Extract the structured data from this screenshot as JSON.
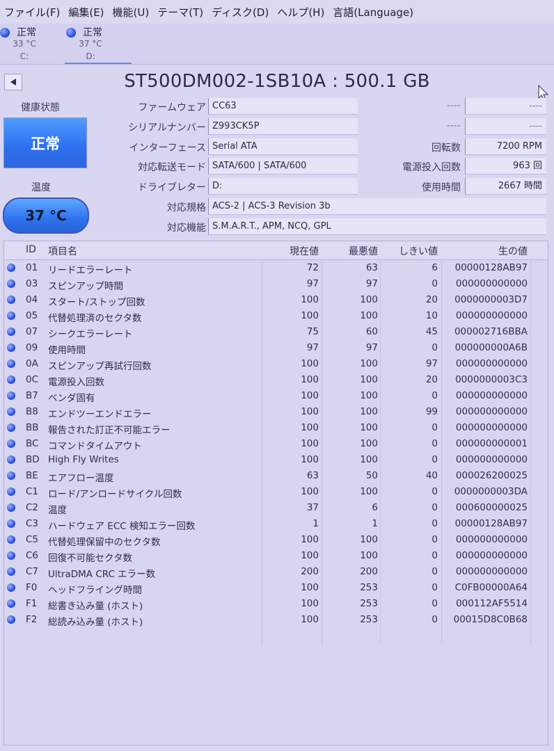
{
  "menu": [
    "ファイル(F)",
    "編集(E)",
    "機能(U)",
    "テーマ(T)",
    "ディスク(D)",
    "ヘルプ(H)",
    "言語(Language)"
  ],
  "drives": [
    {
      "status": "正常",
      "temp": "33 °C",
      "letter": "C:"
    },
    {
      "status": "正常",
      "temp": "37 °C",
      "letter": "D:"
    }
  ],
  "title": "ST500DM002-1SB10A : 500.1 GB",
  "health": {
    "label": "健康状態",
    "value": "正常"
  },
  "temperature": {
    "label": "温度",
    "value": "37 °C"
  },
  "info": {
    "firmware": {
      "label": "ファームウェア",
      "value": "CC63"
    },
    "serial": {
      "label": "シリアルナンバー",
      "value": "Z993CK5P"
    },
    "interface": {
      "label": "インターフェース",
      "value": "Serial ATA"
    },
    "transfer": {
      "label": "対応転送モード",
      "value": "SATA/600 | SATA/600"
    },
    "drive_letter": {
      "label": "ドライブレター",
      "value": "D:"
    },
    "standard": {
      "label": "対応規格",
      "value": "ACS-2 | ACS-3 Revision 3b"
    },
    "features": {
      "label": "対応機能",
      "value": "S.M.A.R.T., APM, NCQ, GPL"
    },
    "blank1": {
      "label": "----",
      "value": "----"
    },
    "blank2": {
      "label": "----",
      "value": "----"
    },
    "rotation": {
      "label": "回転数",
      "value": "7200 RPM"
    },
    "power_count": {
      "label": "電源投入回数",
      "value": "963 回"
    },
    "power_hours": {
      "label": "使用時間",
      "value": "2667 時間"
    }
  },
  "smart": {
    "headers": {
      "id": "ID",
      "name": "項目名",
      "current": "現在値",
      "worst": "最悪値",
      "threshold": "しきい値",
      "raw": "生の値"
    },
    "rows": [
      {
        "id": "01",
        "name": "リードエラーレート",
        "current": "72",
        "worst": "63",
        "threshold": "6",
        "raw": "00000128AB97"
      },
      {
        "id": "03",
        "name": "スピンアップ時間",
        "current": "97",
        "worst": "97",
        "threshold": "0",
        "raw": "000000000000"
      },
      {
        "id": "04",
        "name": "スタート/ストップ回数",
        "current": "100",
        "worst": "100",
        "threshold": "20",
        "raw": "0000000003D7"
      },
      {
        "id": "05",
        "name": "代替処理済のセクタ数",
        "current": "100",
        "worst": "100",
        "threshold": "10",
        "raw": "000000000000"
      },
      {
        "id": "07",
        "name": "シークエラーレート",
        "current": "75",
        "worst": "60",
        "threshold": "45",
        "raw": "000002716BBA"
      },
      {
        "id": "09",
        "name": "使用時間",
        "current": "97",
        "worst": "97",
        "threshold": "0",
        "raw": "000000000A6B"
      },
      {
        "id": "0A",
        "name": "スピンアップ再試行回数",
        "current": "100",
        "worst": "100",
        "threshold": "97",
        "raw": "000000000000"
      },
      {
        "id": "0C",
        "name": "電源投入回数",
        "current": "100",
        "worst": "100",
        "threshold": "20",
        "raw": "0000000003C3"
      },
      {
        "id": "B7",
        "name": "ベンダ固有",
        "current": "100",
        "worst": "100",
        "threshold": "0",
        "raw": "000000000000"
      },
      {
        "id": "B8",
        "name": "エンドツーエンドエラー",
        "current": "100",
        "worst": "100",
        "threshold": "99",
        "raw": "000000000000"
      },
      {
        "id": "BB",
        "name": "報告された訂正不可能エラー",
        "current": "100",
        "worst": "100",
        "threshold": "0",
        "raw": "000000000000"
      },
      {
        "id": "BC",
        "name": "コマンドタイムアウト",
        "current": "100",
        "worst": "100",
        "threshold": "0",
        "raw": "000000000001"
      },
      {
        "id": "BD",
        "name": "High Fly Writes",
        "current": "100",
        "worst": "100",
        "threshold": "0",
        "raw": "000000000000"
      },
      {
        "id": "BE",
        "name": "エアフロー温度",
        "current": "63",
        "worst": "50",
        "threshold": "40",
        "raw": "000026200025"
      },
      {
        "id": "C1",
        "name": "ロード/アンロードサイクル回数",
        "current": "100",
        "worst": "100",
        "threshold": "0",
        "raw": "0000000003DA"
      },
      {
        "id": "C2",
        "name": "温度",
        "current": "37",
        "worst": "6",
        "threshold": "0",
        "raw": "000600000025"
      },
      {
        "id": "C3",
        "name": "ハードウェア ECC 検知エラー回数",
        "current": "1",
        "worst": "1",
        "threshold": "0",
        "raw": "00000128AB97"
      },
      {
        "id": "C5",
        "name": "代替処理保留中のセクタ数",
        "current": "100",
        "worst": "100",
        "threshold": "0",
        "raw": "000000000000"
      },
      {
        "id": "C6",
        "name": "回復不可能セクタ数",
        "current": "100",
        "worst": "100",
        "threshold": "0",
        "raw": "000000000000"
      },
      {
        "id": "C7",
        "name": "UltraDMA CRC エラー数",
        "current": "200",
        "worst": "200",
        "threshold": "0",
        "raw": "000000000000"
      },
      {
        "id": "F0",
        "name": "ヘッドフライング時間",
        "current": "100",
        "worst": "253",
        "threshold": "0",
        "raw": "C0FB00000A64"
      },
      {
        "id": "F1",
        "name": "総書き込み量 (ホスト)",
        "current": "100",
        "worst": "253",
        "threshold": "0",
        "raw": "000112AF5514"
      },
      {
        "id": "F2",
        "name": "総読み込み量 (ホスト)",
        "current": "100",
        "worst": "253",
        "threshold": "0",
        "raw": "00015D8C0B68"
      }
    ]
  }
}
